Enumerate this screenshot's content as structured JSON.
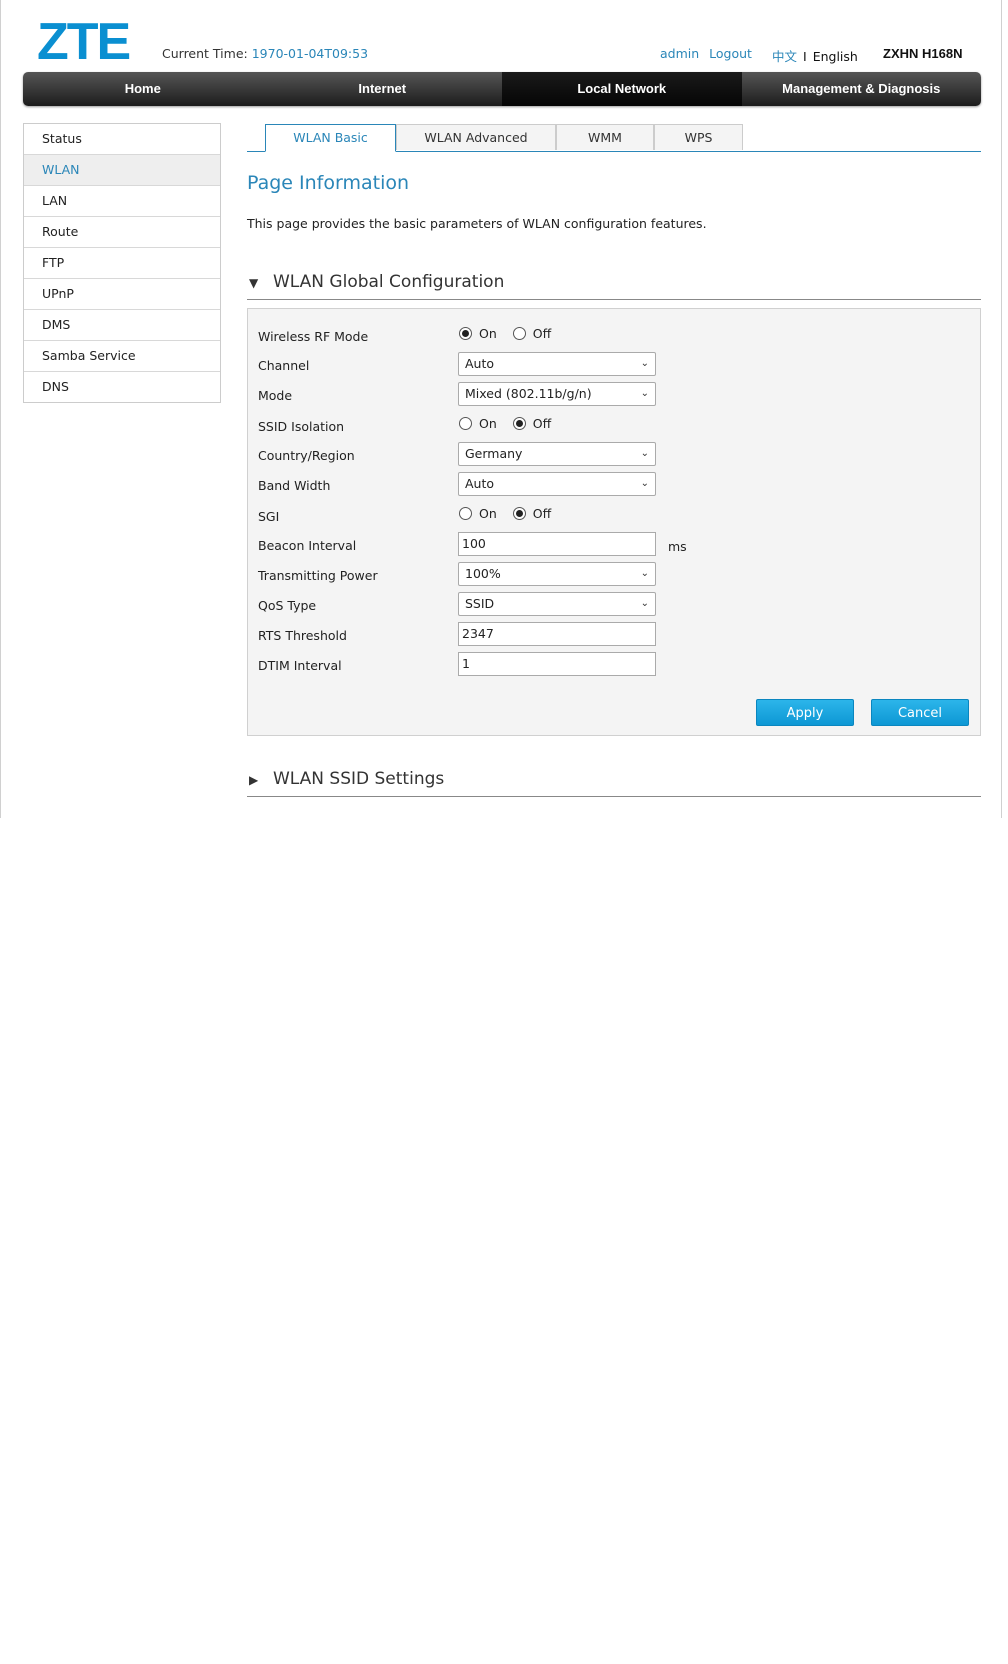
{
  "header": {
    "logo": "ZTE",
    "current_time_label": "Current Time:",
    "current_time_value": "1970-01-04T09:53",
    "user": "admin",
    "logout": "Logout",
    "lang_zh": "中文",
    "lang_sep": "I",
    "lang_en": "English",
    "model": "ZXHN H168N"
  },
  "nav": {
    "items": [
      "Home",
      "Internet",
      "Local Network",
      "Management & Diagnosis"
    ],
    "active": "Local Network"
  },
  "sidebar": {
    "items": [
      "Status",
      "WLAN",
      "LAN",
      "Route",
      "FTP",
      "UPnP",
      "DMS",
      "Samba Service",
      "DNS"
    ],
    "active": "WLAN"
  },
  "tabs": {
    "items": [
      "WLAN Basic",
      "WLAN Advanced",
      "WMM",
      "WPS"
    ],
    "active": "WLAN Basic"
  },
  "page_info": {
    "title": "Page Information",
    "description": "This page provides the basic parameters of WLAN configuration features."
  },
  "global_section": {
    "title": "WLAN Global Configuration",
    "arrow": "▼",
    "fields": {
      "wireless_rf_mode": {
        "label": "Wireless RF Mode",
        "on": "On",
        "off": "Off",
        "selected": "On"
      },
      "channel": {
        "label": "Channel",
        "value": "Auto"
      },
      "mode": {
        "label": "Mode",
        "value": "Mixed (802.11b/g/n)"
      },
      "ssid_isolation": {
        "label": "SSID Isolation",
        "on": "On",
        "off": "Off",
        "selected": "Off"
      },
      "country_region": {
        "label": "Country/Region",
        "value": "Germany"
      },
      "band_width": {
        "label": "Band Width",
        "value": "Auto"
      },
      "sgi": {
        "label": "SGI",
        "on": "On",
        "off": "Off",
        "selected": "Off"
      },
      "beacon_interval": {
        "label": "Beacon Interval",
        "value": "100",
        "unit": "ms"
      },
      "transmitting_power": {
        "label": "Transmitting Power",
        "value": "100%"
      },
      "qos_type": {
        "label": "QoS Type",
        "value": "SSID"
      },
      "rts_threshold": {
        "label": "RTS Threshold",
        "value": "2347"
      },
      "dtim_interval": {
        "label": "DTIM Interval",
        "value": "1"
      }
    },
    "apply": "Apply",
    "cancel": "Cancel"
  },
  "ssid_section": {
    "title": "WLAN SSID Settings",
    "arrow": "▶"
  },
  "colors": {
    "accent": "#2a86b8",
    "logo": "#0a8fd1",
    "button": "#0d97d4"
  }
}
